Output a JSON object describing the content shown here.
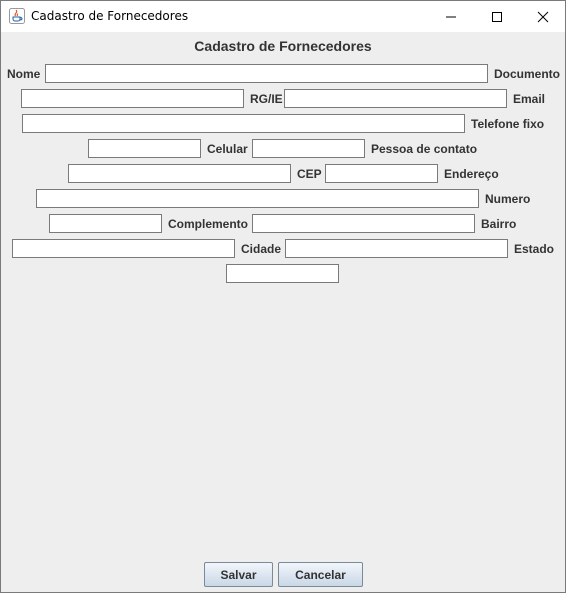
{
  "window": {
    "title": "Cadastro de Fornecedores",
    "controls": [
      "minimize-icon",
      "maximize-icon",
      "close-icon"
    ]
  },
  "form": {
    "title": "Cadastro de Fornecedores",
    "labels": {
      "nome": "Nome",
      "documento": "Documento",
      "rgie": "RG/IE",
      "email": "Email",
      "telefone_fixo": "Telefone fixo",
      "celular": "Celular",
      "pessoa_contato": "Pessoa de contato",
      "cep": "CEP",
      "endereco": "Endereço",
      "numero": "Numero",
      "complemento": "Complemento",
      "bairro": "Bairro",
      "cidade": "Cidade",
      "estado": "Estado"
    },
    "values": {
      "nome": "",
      "documento": "",
      "rgie": "",
      "email": "",
      "telefone_fixo": "",
      "celular": "",
      "pessoa_contato": "",
      "cep": "",
      "endereco": "",
      "numero": "",
      "complemento": "",
      "bairro": "",
      "cidade": "",
      "estado": ""
    }
  },
  "buttons": {
    "salvar": "Salvar",
    "cancelar": "Cancelar"
  }
}
